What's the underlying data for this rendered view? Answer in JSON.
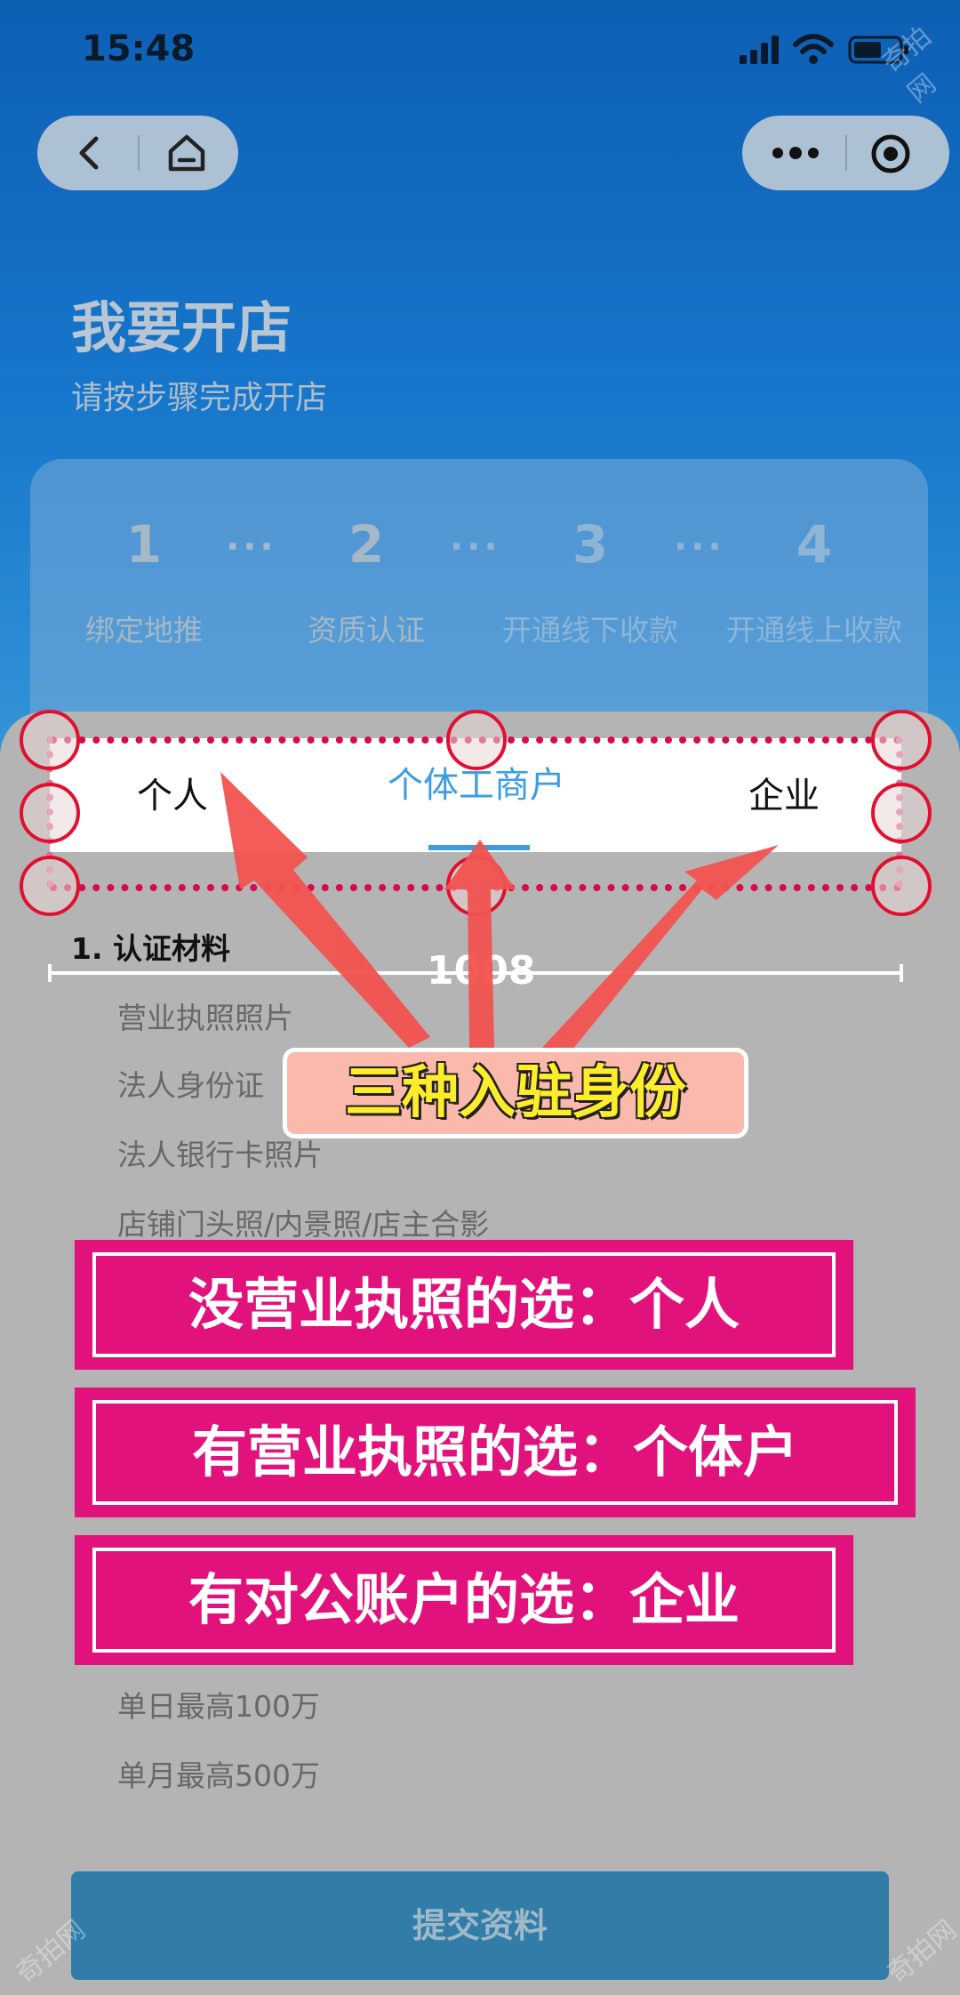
{
  "status_bar": {
    "time": "15:48"
  },
  "page": {
    "title": "我要开店",
    "subtitle": "请按步骤完成开店"
  },
  "steps": [
    {
      "num": "1",
      "label": "绑定地推",
      "active": true
    },
    {
      "num": "2",
      "label": "资质认证",
      "active": true
    },
    {
      "num": "3",
      "label": "开通线下收款",
      "active": false
    },
    {
      "num": "4",
      "label": "开通线上收款",
      "active": false
    }
  ],
  "step_separator": "···",
  "tabs": [
    {
      "label": "个人",
      "selected": false
    },
    {
      "label": "个体工商户",
      "selected": true
    },
    {
      "label": "企业",
      "selected": false
    }
  ],
  "measure_label": "1008",
  "section1": {
    "title": "1. 认证材料",
    "items": [
      "营业执照照片",
      "法人身份证",
      "法人银行卡照片",
      "店铺门头照/内景照/店主合影"
    ]
  },
  "limits": [
    "单日最高100万",
    "单月最高500万"
  ],
  "overlay": {
    "callout": "三种入驻身份",
    "banners": [
      "没营业执照的选：个人",
      "有营业执照的选：个体户",
      "有对公账户的选：企业"
    ]
  },
  "submit_label": "提交资料",
  "watermark": "奇拍网",
  "colors": {
    "tab_selected": "#3c9ee0",
    "banner": "#e2127c",
    "callout_text": "#ffec2a",
    "arrow": "#f2534f"
  }
}
